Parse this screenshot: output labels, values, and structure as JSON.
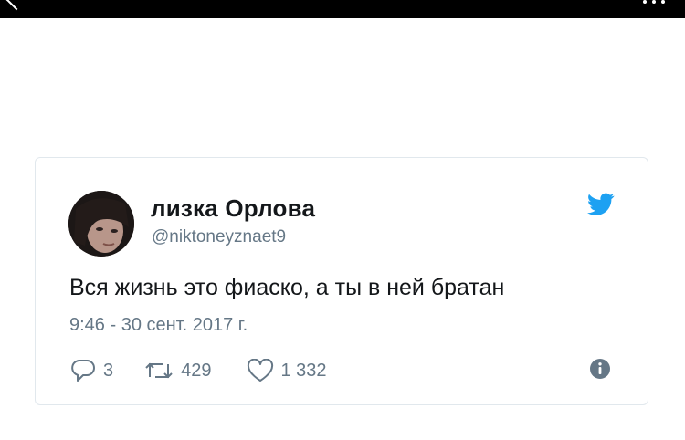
{
  "tweet": {
    "display_name": "лизка Орлова",
    "handle": "@niktoneyznaet9",
    "text": "Вся жизнь это фиаско, а ты в ней братан",
    "timestamp": "9:46 - 30 сент. 2017 г.",
    "reply_count": "3",
    "retweet_count": "429",
    "like_count": "1 332"
  },
  "icons": {
    "back": "chevron-left-icon",
    "more": "more-dots-icon",
    "brand": "twitter-bird-icon",
    "reply": "reply-icon",
    "retweet": "retweet-icon",
    "like": "heart-icon",
    "info": "info-icon"
  },
  "colors": {
    "text": "#14171a",
    "secondary": "#657786",
    "twitter_blue": "#1da1f2",
    "border": "#e1e8ed",
    "topbar": "#000000"
  }
}
